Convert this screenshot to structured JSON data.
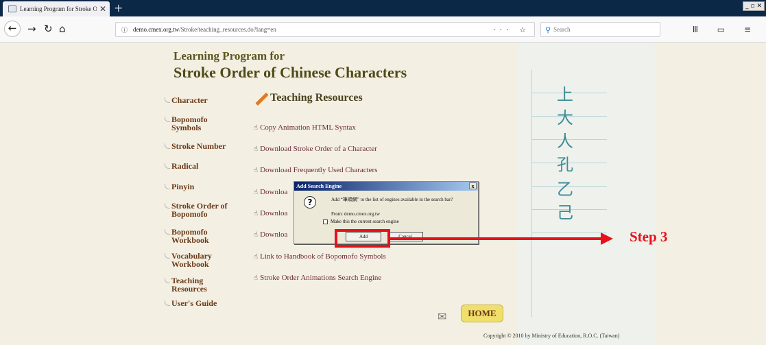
{
  "browser": {
    "tab_title": "Learning Program for Stroke Orde",
    "tab_close": "✕",
    "new_tab": "+",
    "window_buttons": "_ ▫ ✕",
    "url_host": "demo.cmex.org.tw",
    "url_path": "/Stroke/teaching_resources.do?lang=en",
    "url_prefix": "",
    "url_actions": "··· ☆",
    "search_placeholder": "Search",
    "right_icons": "Ⅲ ▭ ≡"
  },
  "site": {
    "title_line1": "Learning Program for",
    "title_line2": "Stroke Order of Chinese Characters"
  },
  "nav": [
    {
      "label": "Character"
    },
    {
      "label": "Bopomofo Symbols"
    },
    {
      "label": "Stroke Number"
    },
    {
      "label": "Radical"
    },
    {
      "label": "Pinyin"
    },
    {
      "label": "Stroke Order of Bopomofo"
    },
    {
      "label": "Bopomofo Workbook"
    },
    {
      "label": "Vocabulary Workbook"
    },
    {
      "label": "Teaching Resources"
    },
    {
      "label": "User's Guide"
    }
  ],
  "section": {
    "heading": "Teaching Resources"
  },
  "resources": [
    {
      "label": "Copy Animation HTML Syntax"
    },
    {
      "label": "Download Stroke Order of a Character"
    },
    {
      "label": "Download Frequently Used Characters"
    },
    {
      "label": "Downloa"
    },
    {
      "label": "Downloa"
    },
    {
      "label": "Downloa"
    },
    {
      "label": "Link to Handbook of Bopomofo Symbols"
    },
    {
      "label": "Stroke Order Animations Search Engine"
    }
  ],
  "glyphs": [
    "上",
    "大",
    "人",
    "孔",
    "乙",
    "己"
  ],
  "footer": {
    "home": "HOME",
    "copyright": "Copyright © 2010 by Ministry of Education, R.O.C. (Taiwan)"
  },
  "dialog": {
    "title": "Add Search Engine",
    "close": "x",
    "message": "Add “筆順網” to the list of engines available in the search bar?",
    "from": "From: demo.cmex.org.tw",
    "checkbox_label": "Make this the current search engine",
    "add_button": "Add",
    "cancel_button": "Cancel"
  },
  "annotation": {
    "step_label": "Step 3",
    "color": "#e8101a"
  }
}
